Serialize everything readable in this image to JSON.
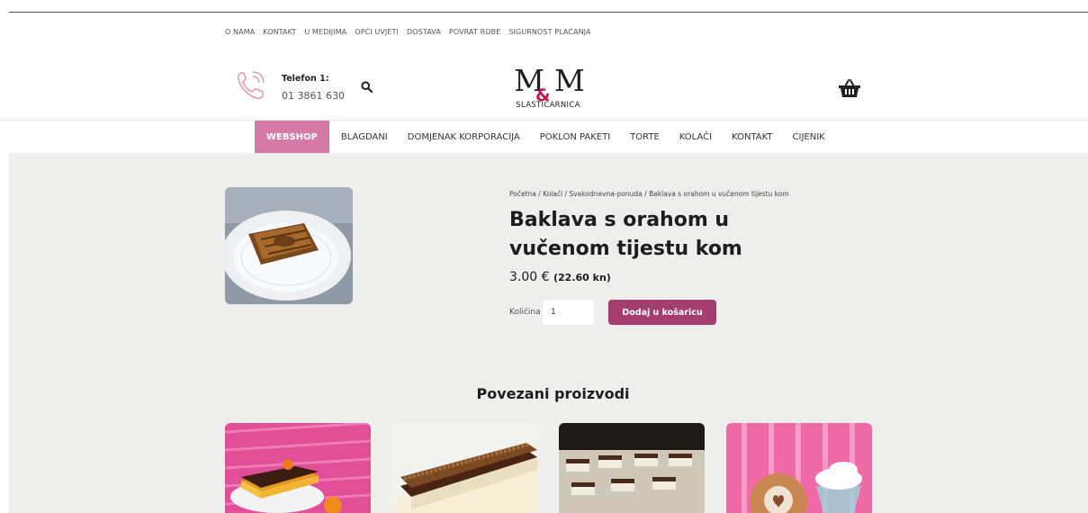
{
  "topnav": [
    "O NAMA",
    "KONTAKT",
    "U MEDIJIMA",
    "OPĆI UVJETI",
    "DOSTAVA",
    "POVRAT ROBE",
    "SIGURNOST PLAĆANJA"
  ],
  "header": {
    "phone_label": "Telefon 1:",
    "phone_number": "01 3861 630",
    "logo_mark_left": "M",
    "logo_amp": "&",
    "logo_mark_right": "M",
    "logo_sub": "SLASTIČARNICA"
  },
  "mainnav": [
    "WEBSHOP",
    "BLAGDANI",
    "DOMJENAK KORPORACIJA",
    "POKLON PAKETI",
    "TORTE",
    "KOLAČI",
    "KONTAKT",
    "CIJENIK"
  ],
  "product": {
    "breadcrumb": "Početna / Kolači / Svakodnevna-ponuda / Baklava s orahom u vučenom tijestu kom",
    "title": "Baklava s orahom u vučenom tijestu kom",
    "price_eur": "3.00 €",
    "price_kn": "(22.60 kn)",
    "qty_label": "Količina",
    "qty_value": "1",
    "add_to_cart": "Dodaj u košaricu"
  },
  "related": {
    "title": "Povezani proizvodi"
  },
  "colors": {
    "accent_pink": "#d47aa5",
    "button_plum": "#a53d6e",
    "background": "#eeeeec"
  }
}
